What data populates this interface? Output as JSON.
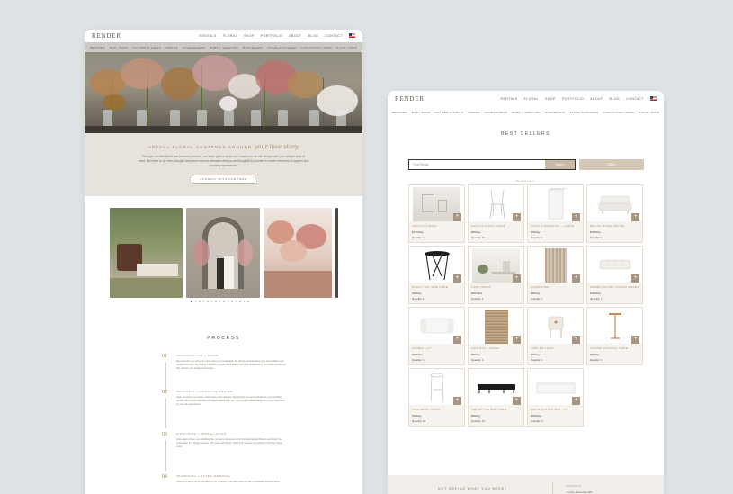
{
  "brand": "RENDER",
  "topnav": [
    "RENTALS",
    "FLORAL",
    "SHOP",
    "PORTFOLIO",
    "ABOUT",
    "BLOG",
    "CONTACT"
  ],
  "subnav": [
    "BENCHES",
    "BAR / BARS",
    "DAY BED & SOFAS",
    "TABLES",
    "ACCESSORIES",
    "BARS + SHELVING",
    "BACKDROPS",
    "STAGE PACKAGES",
    "FUNCTIONAL ITEMS",
    "RUGS / PADS"
  ],
  "page1": {
    "intro_heading": "ARTFUL FLORAL CENTERED AROUND",
    "intro_script": "your love story",
    "intro_text": "Through our intentional and personal process, our team gets to know our couples as we mix design with your unique story in mind. We listen to all every thought and piece and mix elevated designs we thoughtfully provide to create moments of support and stunning experiences.",
    "intro_button": "CONNECT WITH OUR TEAM",
    "process_title": "PROCESS",
    "steps": [
      {
        "num": "01",
        "title": "CONSULTATION + MOOD",
        "body": "We work with you and your event team to conceptualize the design, incorporating your personalities and unique love story. By sharing inspiration photos, floral details and your overall vision, we create a proposal that reflects your design and budget."
      },
      {
        "num": "02",
        "title": "PROPOSAL + CREATIVE REVIEW",
        "body": "Upon receiving your quote, we'll review and make any adjustments. To secure florals for your wedding, Render will require a deposit and signed agreement. We will continue collaborating over email and phone as your day approaches."
      },
      {
        "num": "03",
        "title": "FINALIZING + INSTALLATION",
        "body": "A few days before your wedding day, our team will source all of the hand-picked blooms and begin the preparation and design process. Our team will deliver, install and oversee everything on the day of your event."
      },
      {
        "num": "04",
        "title": "TEARDOWN + AFTER WEDDING",
        "body": "Ceremony items can be re-used for the reception. Our team stays on site to transition arrangements."
      }
    ]
  },
  "page2": {
    "title": "BEST SELLERS",
    "search_placeholder": "Find Rental",
    "search_button": "Search",
    "filter_button": "Filters",
    "results_label": "Rentals Items",
    "products": [
      {
        "name": "ACRYLIC CHAIRS",
        "price": "$3.50/Day",
        "qty": "Quantity: 1"
      },
      {
        "name": "ACRYLIC GHOST TABLE",
        "price": "$95/Day",
        "qty": "Quantity: 10"
      },
      {
        "name": "ACRYLIC PEDESTAL — LARGE",
        "price": "$75/Day",
        "qty": "Quantity: 1"
      },
      {
        "name": "BELLINI MODEL SETTEE",
        "price": "$185/Day",
        "qty": "Quantity: 1"
      },
      {
        "name": "BLACK TRAY SIDE TABLE",
        "price": "$25/Day",
        "qty": "Quantity: 1"
      },
      {
        "name": "CAFE TABLES",
        "price": "$65/Table",
        "qty": "Quantity: 1"
      },
      {
        "name": "CARPENTER",
        "price": "$85/Day",
        "qty": "Quantity: 1"
      },
      {
        "name": "CREME QUILTED LOUNGE PIECES",
        "price": "$185/Day",
        "qty": "Quantity: 1"
      },
      {
        "name": "DAYBED - 6'7\"",
        "price": "$300/Day",
        "qty": "Quantity: 1"
      },
      {
        "name": "JUTE RUG - LARGE",
        "price": "$80/Day",
        "qty": "Quantity: 1"
      },
      {
        "name": "JUMP ER CHAIR",
        "price": "$45/Day",
        "qty": "Quantity: 1"
      },
      {
        "name": "COPPER COCKTAIL TABLE",
        "price": "$45/Day",
        "qty": "Quantity: 1"
      },
      {
        "name": "TALL GHOST STOOL",
        "price": "$15/Day",
        "qty": "Quantity: 10"
      },
      {
        "name": "TEN BOTTLE BAR TABLE",
        "price": "$95/Day",
        "qty": "Quantity: 10"
      },
      {
        "name": "WHITE ACRYLIC BAR - 8'7\"",
        "price": "$150/Day",
        "qty": "Quantity: 2"
      }
    ],
    "footer_title": "NOT SEEING WHAT YOU NEED?",
    "footer_right_label": "RENTALS",
    "footer_right_link": "Luxury Event Rentals"
  }
}
